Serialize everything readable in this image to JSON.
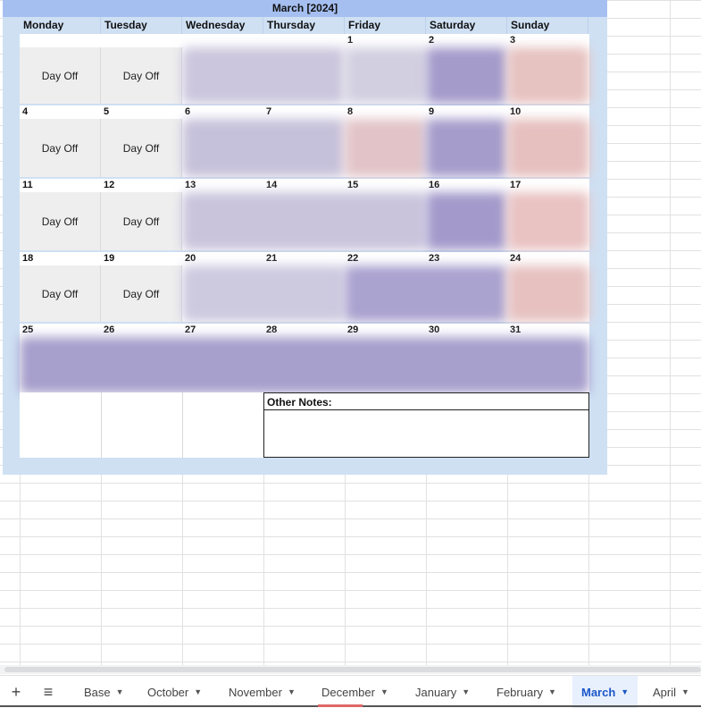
{
  "calendar": {
    "title": "March [2024]",
    "day_headers": [
      "Monday",
      "Tuesday",
      "Wednesday",
      "Thursday",
      "Friday",
      "Saturday",
      "Sunday"
    ],
    "weeks": [
      {
        "dates": [
          "",
          "",
          "",
          "",
          "1",
          "2",
          "3"
        ]
      },
      {
        "dates": [
          "4",
          "5",
          "6",
          "7",
          "8",
          "9",
          "10"
        ]
      },
      {
        "dates": [
          "11",
          "12",
          "13",
          "14",
          "15",
          "16",
          "17"
        ]
      },
      {
        "dates": [
          "18",
          "19",
          "20",
          "21",
          "22",
          "23",
          "24"
        ]
      },
      {
        "dates": [
          "25",
          "26",
          "27",
          "28",
          "29",
          "30",
          "31"
        ]
      }
    ],
    "day_off_label": "Day Off",
    "notes_label": "Other Notes:"
  },
  "colors": {
    "title_bar": "#a5bff1",
    "frame": "#cfe0f3",
    "blur_purple": "#9a91c4",
    "blur_lavender": "#c9c4dc",
    "blur_pink": "#e8b9b4",
    "active_tab": "#1a56c8"
  },
  "tabbar": {
    "add_icon": "plus-icon",
    "menu_icon": "hamburger-icon",
    "add_glyph": "+",
    "menu_glyph": "≡",
    "sheets": [
      {
        "label": "Base",
        "active": false
      },
      {
        "label": "October",
        "active": false
      },
      {
        "label": "November",
        "active": false
      },
      {
        "label": "December",
        "active": false
      },
      {
        "label": "January",
        "active": false
      },
      {
        "label": "February",
        "active": false
      },
      {
        "label": "March",
        "active": true
      },
      {
        "label": "April",
        "active": false
      }
    ]
  }
}
